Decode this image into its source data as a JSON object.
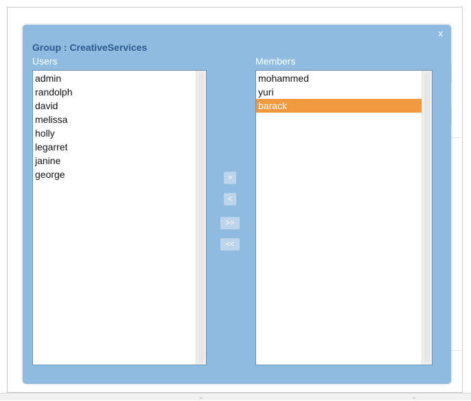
{
  "dialog": {
    "close_label": "x",
    "group_label": "Group : CreativeServices",
    "users_heading": "Users",
    "members_heading": "Members"
  },
  "users": [
    "admin",
    "randolph",
    "david",
    "melissa",
    "holly",
    "legarret",
    "janine",
    "george"
  ],
  "members": [
    "mohammed",
    "yuri",
    "barack"
  ],
  "selected_member": "barack",
  "buttons": {
    "add": ">",
    "remove": "<",
    "add_all": ">>",
    "remove_all": "<<"
  },
  "colors": {
    "dialog_bg": "#8fbbe1",
    "title_text": "#2c5a8e",
    "selection": "#f0993f",
    "button_bg": "#bdd4ea"
  }
}
